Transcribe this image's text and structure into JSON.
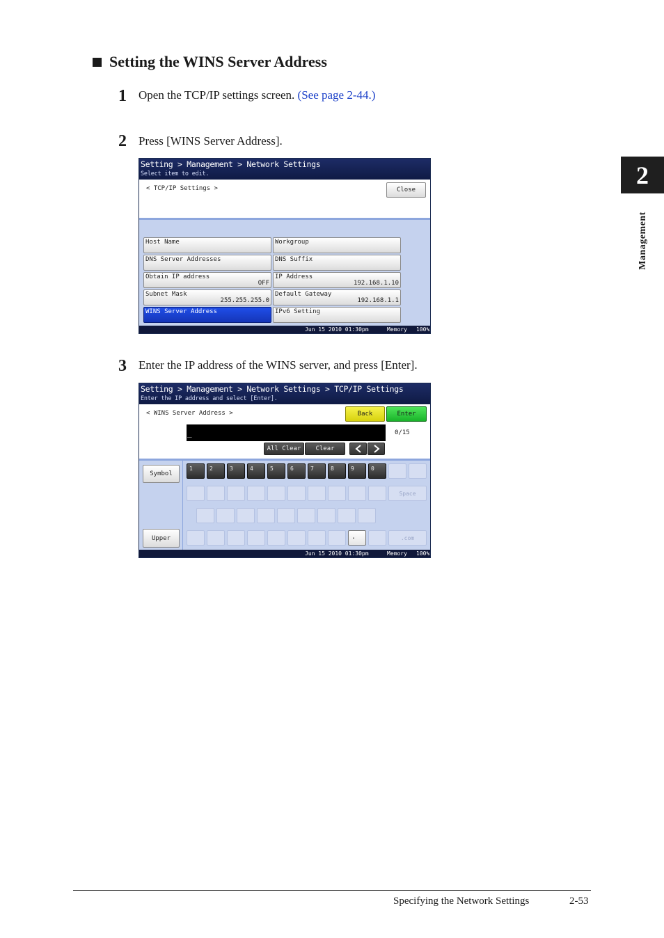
{
  "heading": "Setting the WINS Server Address",
  "steps": [
    {
      "num": "1",
      "text": "Open the TCP/IP settings screen.",
      "link": "(See page 2-44.)"
    },
    {
      "num": "2",
      "text": "Press [WINS Server Address]."
    },
    {
      "num": "3",
      "text": "Enter the IP address of the WINS server, and press [Enter]."
    }
  ],
  "side": {
    "chapter": "2",
    "label": "Management"
  },
  "footer": {
    "section": "Specifying the Network Settings",
    "page": "2-53"
  },
  "screen1": {
    "breadcrumb": "Setting > Management > Network Settings",
    "hint": "Select item to edit.",
    "section": "< TCP/IP Settings >",
    "close": "Close",
    "buttons": [
      {
        "label": "Host Name",
        "value": ""
      },
      {
        "label": "Workgroup",
        "value": ""
      },
      {
        "label": "DNS Server Addresses",
        "value": ""
      },
      {
        "label": "DNS Suffix",
        "value": ""
      },
      {
        "label": "Obtain IP address",
        "value": "OFF"
      },
      {
        "label": "IP Address",
        "value": "192.168.1.10"
      },
      {
        "label": "Subnet Mask",
        "value": "255.255.255.0"
      },
      {
        "label": "Default Gateway",
        "value": "192.168.1.1"
      },
      {
        "label": "WINS Server Address",
        "value": ""
      },
      {
        "label": "IPv6 Setting",
        "value": ""
      }
    ],
    "status": {
      "datetime": "Jun 15 2010 01:30pm",
      "memory_label": "Memory",
      "memory_value": "100%"
    }
  },
  "screen2": {
    "breadcrumb": "Setting > Management > Network Settings > TCP/IP Settings",
    "hint": "Enter the IP address and select [Enter].",
    "section": "< WINS Server Address >",
    "back": "Back",
    "enter": "Enter",
    "input_value": "_",
    "char_count": "0/15",
    "all_clear": "All Clear",
    "clear": "Clear",
    "symbol": "Symbol",
    "upper": "Upper",
    "space": "Space",
    "dotcom": ".com",
    "digit_keys": [
      "1",
      "2",
      "3",
      "4",
      "5",
      "6",
      "7",
      "8",
      "9",
      "0"
    ],
    "dot_key": ".",
    "status": {
      "datetime": "Jun 15 2010 01:30pm",
      "memory_label": "Memory",
      "memory_value": "100%"
    }
  }
}
